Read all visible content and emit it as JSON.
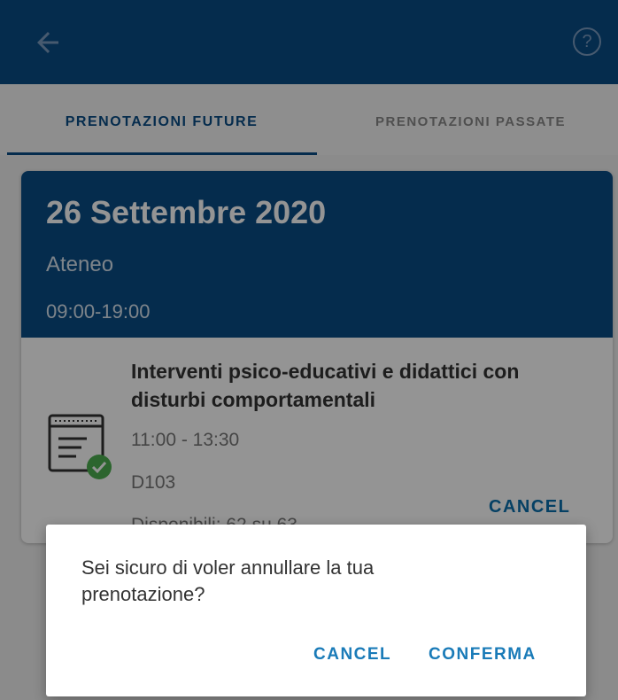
{
  "appbar": {
    "back_icon": "arrow-left-icon",
    "help_icon": "help-circle-icon",
    "help_glyph": "?"
  },
  "tabs": [
    {
      "label": "PRENOTAZIONI FUTURE",
      "selected": true
    },
    {
      "label": "PRENOTAZIONI PASSATE",
      "selected": false
    }
  ],
  "booking": {
    "date": "26 Settembre 2020",
    "location": "Ateneo",
    "hours": "09:00-19:00",
    "event": {
      "icon": "calendar-check-icon",
      "title": "Interventi psico-educativi e didattici con disturbi comportamentali",
      "time": "11:00 - 13:30",
      "room": "D103",
      "availability": "Disponibili: 62 su 63"
    },
    "cancel_label": "CANCEL"
  },
  "dialog": {
    "message": "Sei sicuro di voler annullare la tua prenotazione?",
    "cancel_label": "CANCEL",
    "confirm_label": "CONFERMA"
  },
  "colors": {
    "primary": "#0a4c86",
    "accent": "#1a7bb8",
    "scrim": "rgba(0,0,0,0.42)"
  }
}
